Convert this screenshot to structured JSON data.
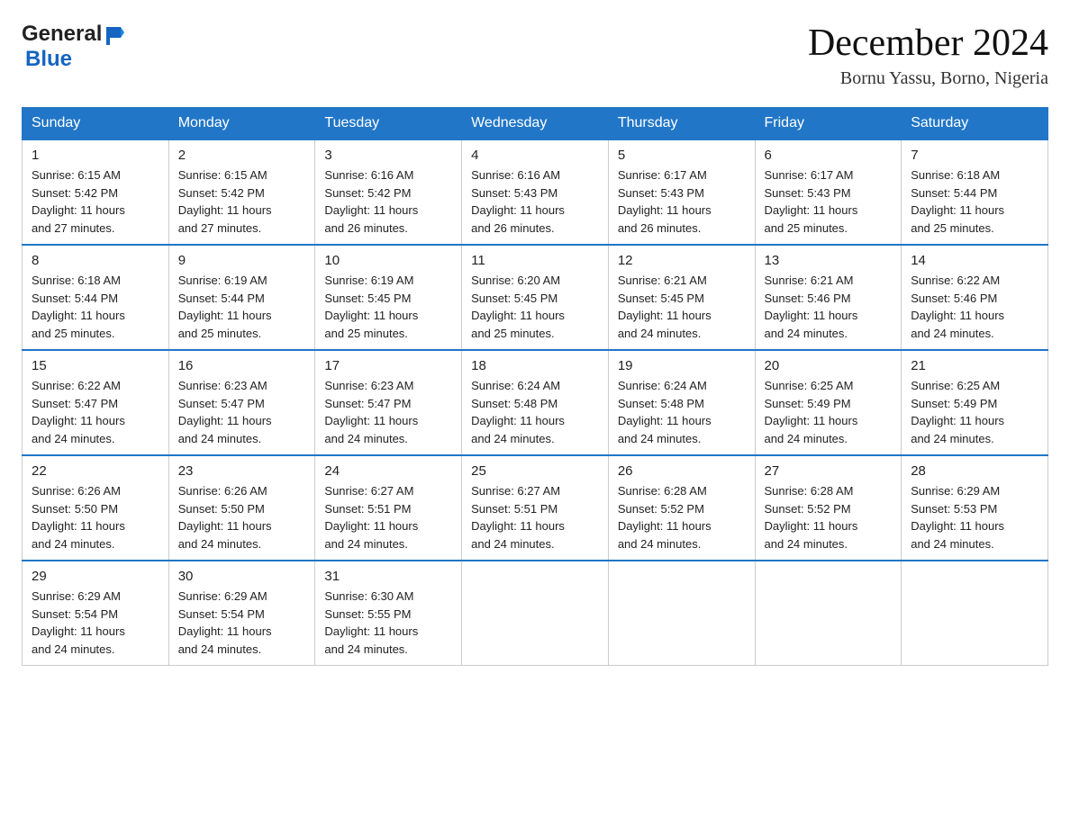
{
  "header": {
    "logo": {
      "text_general": "General",
      "text_blue": "Blue",
      "aria": "GeneralBlue Logo"
    },
    "month_title": "December 2024",
    "location": "Bornu Yassu, Borno, Nigeria"
  },
  "weekdays": [
    "Sunday",
    "Monday",
    "Tuesday",
    "Wednesday",
    "Thursday",
    "Friday",
    "Saturday"
  ],
  "weeks": [
    [
      {
        "day": "1",
        "sunrise": "6:15 AM",
        "sunset": "5:42 PM",
        "daylight": "11 hours and 27 minutes."
      },
      {
        "day": "2",
        "sunrise": "6:15 AM",
        "sunset": "5:42 PM",
        "daylight": "11 hours and 27 minutes."
      },
      {
        "day": "3",
        "sunrise": "6:16 AM",
        "sunset": "5:42 PM",
        "daylight": "11 hours and 26 minutes."
      },
      {
        "day": "4",
        "sunrise": "6:16 AM",
        "sunset": "5:43 PM",
        "daylight": "11 hours and 26 minutes."
      },
      {
        "day": "5",
        "sunrise": "6:17 AM",
        "sunset": "5:43 PM",
        "daylight": "11 hours and 26 minutes."
      },
      {
        "day": "6",
        "sunrise": "6:17 AM",
        "sunset": "5:43 PM",
        "daylight": "11 hours and 25 minutes."
      },
      {
        "day": "7",
        "sunrise": "6:18 AM",
        "sunset": "5:44 PM",
        "daylight": "11 hours and 25 minutes."
      }
    ],
    [
      {
        "day": "8",
        "sunrise": "6:18 AM",
        "sunset": "5:44 PM",
        "daylight": "11 hours and 25 minutes."
      },
      {
        "day": "9",
        "sunrise": "6:19 AM",
        "sunset": "5:44 PM",
        "daylight": "11 hours and 25 minutes."
      },
      {
        "day": "10",
        "sunrise": "6:19 AM",
        "sunset": "5:45 PM",
        "daylight": "11 hours and 25 minutes."
      },
      {
        "day": "11",
        "sunrise": "6:20 AM",
        "sunset": "5:45 PM",
        "daylight": "11 hours and 25 minutes."
      },
      {
        "day": "12",
        "sunrise": "6:21 AM",
        "sunset": "5:45 PM",
        "daylight": "11 hours and 24 minutes."
      },
      {
        "day": "13",
        "sunrise": "6:21 AM",
        "sunset": "5:46 PM",
        "daylight": "11 hours and 24 minutes."
      },
      {
        "day": "14",
        "sunrise": "6:22 AM",
        "sunset": "5:46 PM",
        "daylight": "11 hours and 24 minutes."
      }
    ],
    [
      {
        "day": "15",
        "sunrise": "6:22 AM",
        "sunset": "5:47 PM",
        "daylight": "11 hours and 24 minutes."
      },
      {
        "day": "16",
        "sunrise": "6:23 AM",
        "sunset": "5:47 PM",
        "daylight": "11 hours and 24 minutes."
      },
      {
        "day": "17",
        "sunrise": "6:23 AM",
        "sunset": "5:47 PM",
        "daylight": "11 hours and 24 minutes."
      },
      {
        "day": "18",
        "sunrise": "6:24 AM",
        "sunset": "5:48 PM",
        "daylight": "11 hours and 24 minutes."
      },
      {
        "day": "19",
        "sunrise": "6:24 AM",
        "sunset": "5:48 PM",
        "daylight": "11 hours and 24 minutes."
      },
      {
        "day": "20",
        "sunrise": "6:25 AM",
        "sunset": "5:49 PM",
        "daylight": "11 hours and 24 minutes."
      },
      {
        "day": "21",
        "sunrise": "6:25 AM",
        "sunset": "5:49 PM",
        "daylight": "11 hours and 24 minutes."
      }
    ],
    [
      {
        "day": "22",
        "sunrise": "6:26 AM",
        "sunset": "5:50 PM",
        "daylight": "11 hours and 24 minutes."
      },
      {
        "day": "23",
        "sunrise": "6:26 AM",
        "sunset": "5:50 PM",
        "daylight": "11 hours and 24 minutes."
      },
      {
        "day": "24",
        "sunrise": "6:27 AM",
        "sunset": "5:51 PM",
        "daylight": "11 hours and 24 minutes."
      },
      {
        "day": "25",
        "sunrise": "6:27 AM",
        "sunset": "5:51 PM",
        "daylight": "11 hours and 24 minutes."
      },
      {
        "day": "26",
        "sunrise": "6:28 AM",
        "sunset": "5:52 PM",
        "daylight": "11 hours and 24 minutes."
      },
      {
        "day": "27",
        "sunrise": "6:28 AM",
        "sunset": "5:52 PM",
        "daylight": "11 hours and 24 minutes."
      },
      {
        "day": "28",
        "sunrise": "6:29 AM",
        "sunset": "5:53 PM",
        "daylight": "11 hours and 24 minutes."
      }
    ],
    [
      {
        "day": "29",
        "sunrise": "6:29 AM",
        "sunset": "5:54 PM",
        "daylight": "11 hours and 24 minutes."
      },
      {
        "day": "30",
        "sunrise": "6:29 AM",
        "sunset": "5:54 PM",
        "daylight": "11 hours and 24 minutes."
      },
      {
        "day": "31",
        "sunrise": "6:30 AM",
        "sunset": "5:55 PM",
        "daylight": "11 hours and 24 minutes."
      },
      null,
      null,
      null,
      null
    ]
  ],
  "labels": {
    "sunrise": "Sunrise:",
    "sunset": "Sunset:",
    "daylight": "Daylight:"
  }
}
